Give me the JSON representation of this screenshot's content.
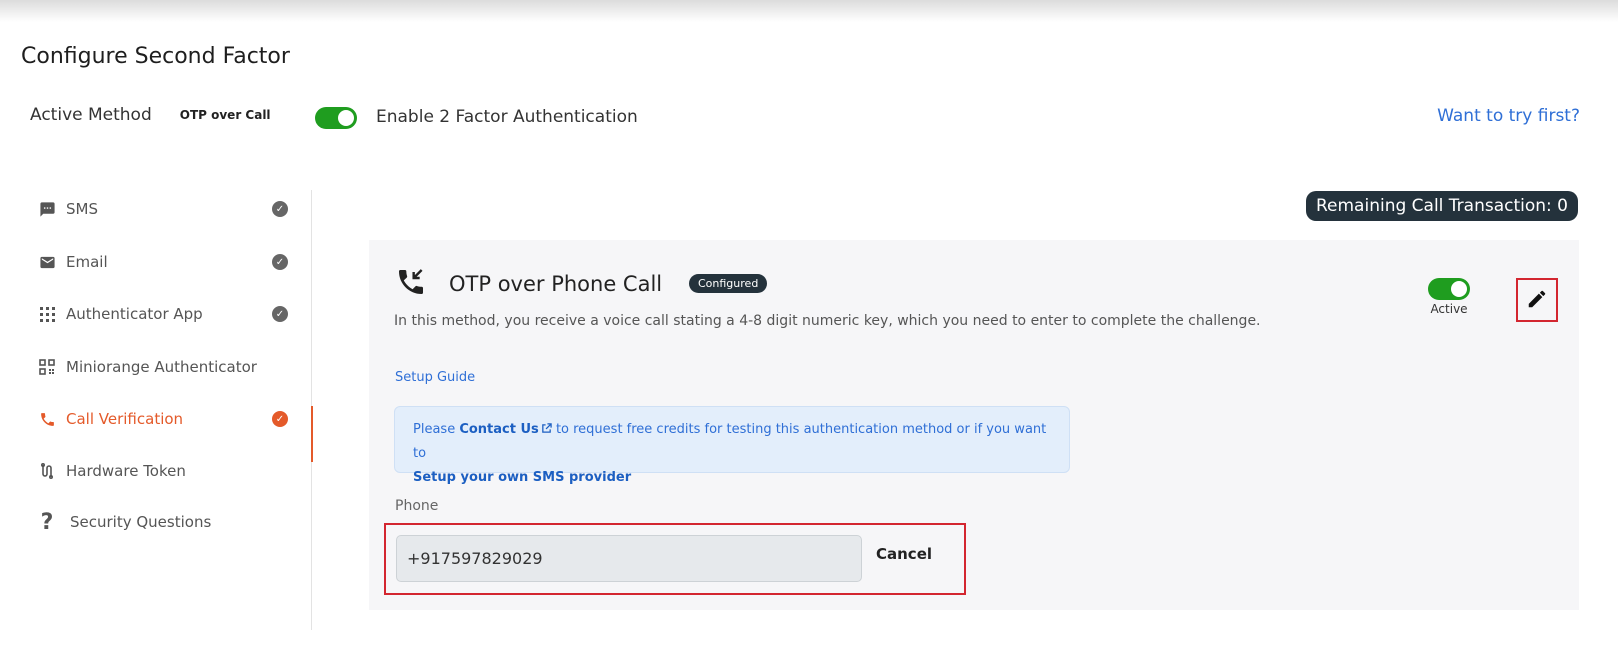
{
  "page": {
    "title": "Configure Second Factor"
  },
  "active_method": {
    "label": "Active Method",
    "value": "OTP over Call"
  },
  "two_factor": {
    "label": "Enable 2 Factor Authentication",
    "enabled": true
  },
  "try_link": "Want to try first?",
  "sidebar": {
    "items": [
      {
        "label": "SMS",
        "icon": "sms-icon",
        "configured": true,
        "active": false
      },
      {
        "label": "Email",
        "icon": "mail-icon",
        "configured": true,
        "active": false
      },
      {
        "label": "Authenticator App",
        "icon": "grid-icon",
        "configured": true,
        "active": false
      },
      {
        "label": "Miniorange Authenticator",
        "icon": "qr-icon",
        "configured": false,
        "active": false
      },
      {
        "label": "Call Verification",
        "icon": "phone-icon",
        "configured": true,
        "active": true
      },
      {
        "label": "Hardware Token",
        "icon": "token-icon",
        "configured": false,
        "active": false
      },
      {
        "label": "Security Questions",
        "icon": "question-icon",
        "configured": false,
        "active": false
      }
    ]
  },
  "remaining": "Remaining Call Transaction: 0",
  "card": {
    "title": "OTP over Phone Call",
    "badge": "Configured",
    "status": "Active",
    "description": "In this method, you receive a voice call stating a 4-8 digit numeric key, which you need to enter to complete the challenge.",
    "setup_guide": "Setup Guide",
    "info": {
      "prefix": "Please",
      "contact": "Contact Us",
      "middle": "to request free credits for testing this authentication method or if you want to",
      "provider": "Setup your own SMS provider"
    },
    "phone": {
      "label": "Phone",
      "value": "+917597829029",
      "cancel": "Cancel"
    }
  },
  "colors": {
    "accent": "#e45a2a",
    "link": "#2f6fd6",
    "toggle": "#1f9d1f",
    "dark_badge": "#24323c",
    "highlight": "#d32630"
  }
}
